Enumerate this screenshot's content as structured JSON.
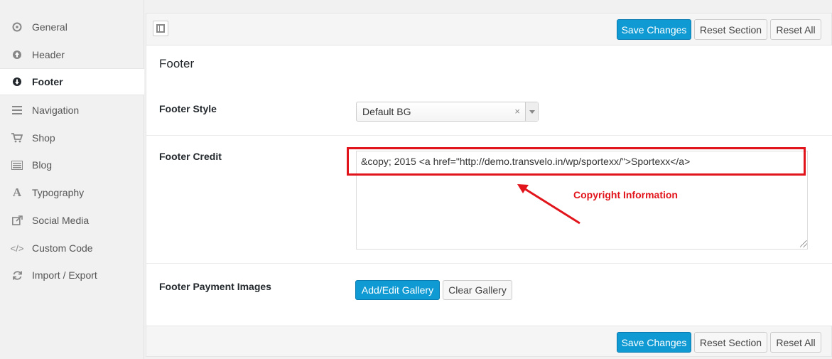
{
  "sidebar": {
    "items": [
      {
        "label": "General",
        "icon": "gear-icon"
      },
      {
        "label": "Header",
        "icon": "arrow-up-circle-icon"
      },
      {
        "label": "Footer",
        "icon": "arrow-down-circle-icon",
        "active": true
      },
      {
        "label": "Navigation",
        "icon": "menu-lines-icon"
      },
      {
        "label": "Shop",
        "icon": "cart-icon"
      },
      {
        "label": "Blog",
        "icon": "list-icon"
      },
      {
        "label": "Typography",
        "icon": "typography-icon"
      },
      {
        "label": "Social Media",
        "icon": "share-icon"
      },
      {
        "label": "Custom Code",
        "icon": "code-icon"
      },
      {
        "label": "Import / Export",
        "icon": "refresh-icon"
      }
    ]
  },
  "toolbar": {
    "save_label": "Save Changes",
    "reset_section_label": "Reset Section",
    "reset_all_label": "Reset All"
  },
  "main": {
    "section_title": "Footer",
    "footer_style": {
      "label": "Footer Style",
      "selected": "Default BG",
      "clear": "×"
    },
    "footer_credit": {
      "label": "Footer Credit",
      "value": "&copy; 2015 <a href=\"http://demo.transvelo.in/wp/sportexx/\">Sportexx</a>"
    },
    "footer_payment": {
      "label": "Footer Payment Images",
      "add_edit_label": "Add/Edit Gallery",
      "clear_label": "Clear Gallery"
    }
  },
  "annotation": {
    "text": "Copyright Information",
    "color": "#e2141b"
  },
  "colors": {
    "accent": "#0f9ad3",
    "sidebar_bg": "#f1f1f1",
    "panel_bg": "#ffffff"
  }
}
